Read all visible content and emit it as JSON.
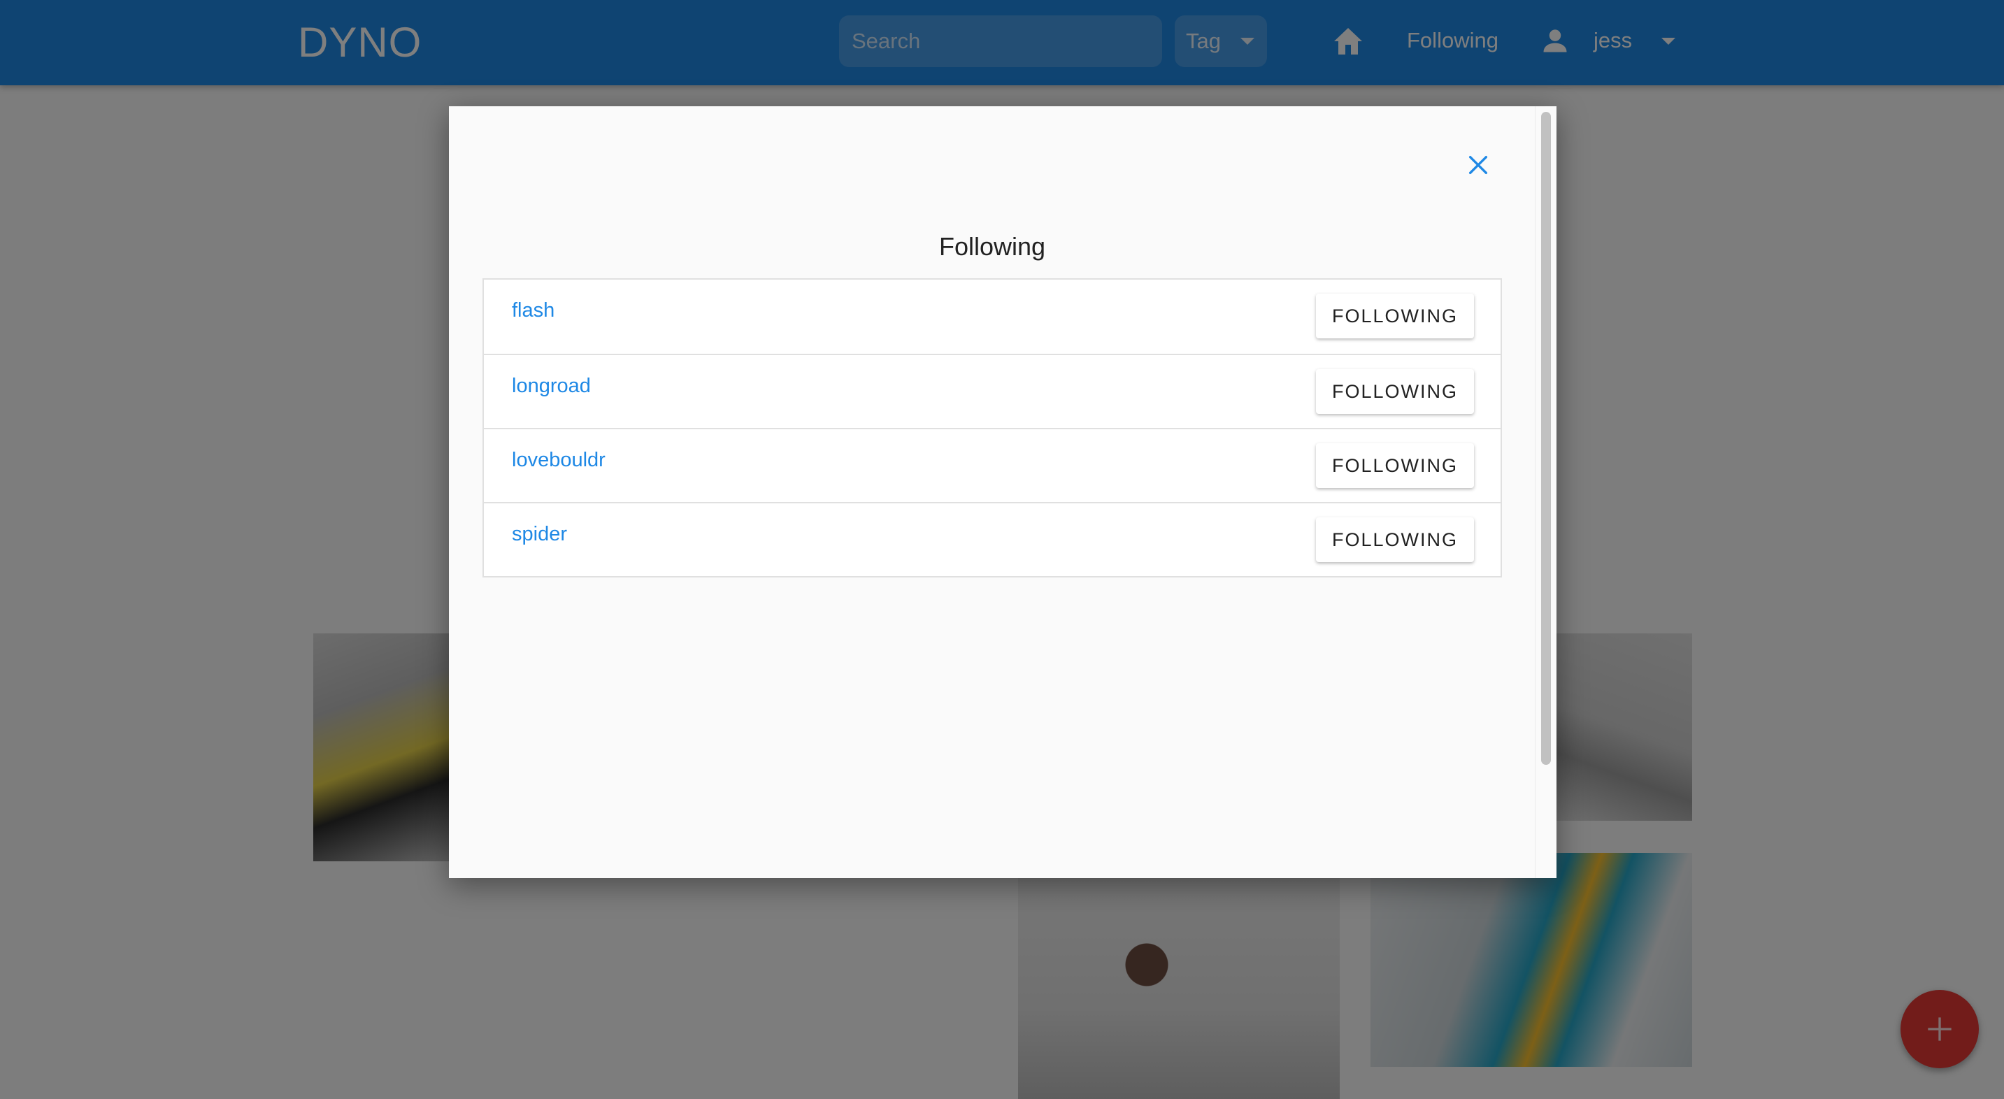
{
  "header": {
    "logo": "DYNO",
    "search": {
      "placeholder": "Search",
      "value": ""
    },
    "tag_select": {
      "selected": "Tag"
    },
    "nav": {
      "home_icon": "home-icon",
      "following_label": "Following"
    },
    "user": {
      "icon": "person-icon",
      "name": "jess",
      "menu_icon": "caret-down-icon"
    }
  },
  "dialog": {
    "title": "Following",
    "close_icon": "close-icon",
    "users": [
      {
        "name": "flash",
        "button": "FOLLOWING"
      },
      {
        "name": "longroad",
        "button": "FOLLOWING"
      },
      {
        "name": "lovebouldr",
        "button": "FOLLOWING"
      },
      {
        "name": "spider",
        "button": "FOLLOWING"
      }
    ]
  },
  "fab": {
    "icon": "plus-icon"
  },
  "colors": {
    "appbar": "#1e88e5",
    "link": "#1e88e5",
    "fab": "#e53935",
    "dialog_bg": "#fafafa"
  }
}
